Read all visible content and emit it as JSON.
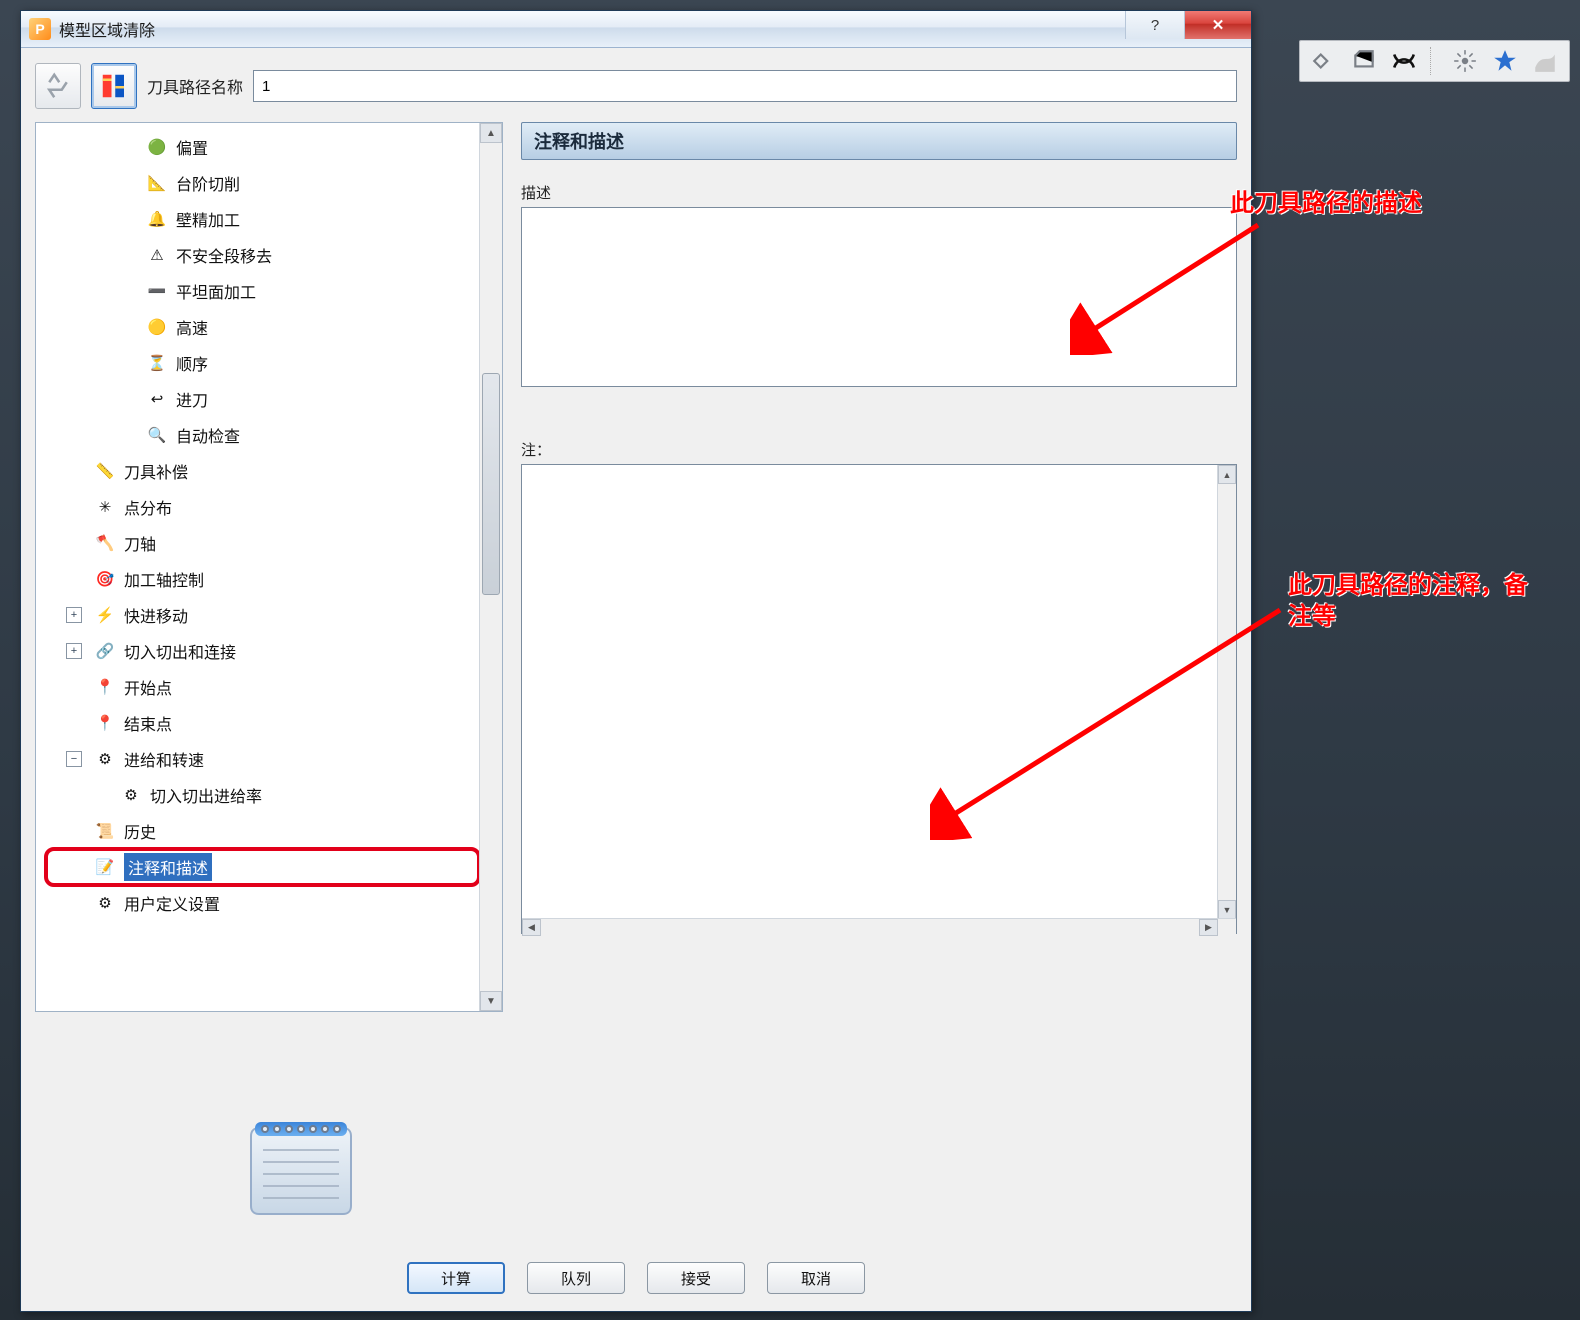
{
  "window": {
    "title": "模型区域清除",
    "app_letter": "P",
    "help_symbol": "?",
    "close_symbol": "✕"
  },
  "header": {
    "path_label": "刀具路径名称",
    "path_value": "1"
  },
  "tree": {
    "items": [
      {
        "indent": 3,
        "icon": "🟢",
        "label": "偏置"
      },
      {
        "indent": 3,
        "icon": "📐",
        "label": "台阶切削"
      },
      {
        "indent": 3,
        "icon": "🔔",
        "label": "壁精加工"
      },
      {
        "indent": 3,
        "icon": "⚠",
        "label": "不安全段移去"
      },
      {
        "indent": 3,
        "icon": "➖",
        "label": "平坦面加工"
      },
      {
        "indent": 3,
        "icon": "🟡",
        "label": "高速"
      },
      {
        "indent": 3,
        "icon": "⏳",
        "label": "顺序"
      },
      {
        "indent": 3,
        "icon": "↩",
        "label": "进刀"
      },
      {
        "indent": 3,
        "icon": "🔍",
        "label": "自动检查"
      },
      {
        "indent": 1,
        "icon": "📏",
        "label": "刀具补偿"
      },
      {
        "indent": 1,
        "icon": "✳",
        "label": "点分布"
      },
      {
        "indent": 1,
        "icon": "🪓",
        "label": "刀轴"
      },
      {
        "indent": 1,
        "icon": "🎯",
        "label": "加工轴控制"
      },
      {
        "indent": 1,
        "exp": "+",
        "icon": "⚡",
        "label": "快进移动"
      },
      {
        "indent": 1,
        "exp": "+",
        "icon": "🔗",
        "label": "切入切出和连接"
      },
      {
        "indent": 1,
        "icon": "📍",
        "label": "开始点"
      },
      {
        "indent": 1,
        "icon": "📍",
        "label": "结束点"
      },
      {
        "indent": 1,
        "exp": "−",
        "icon": "⚙",
        "label": "进给和转速"
      },
      {
        "indent": 2,
        "icon": "⚙",
        "label": "切入切出进给率"
      },
      {
        "indent": 1,
        "icon": "📜",
        "label": "历史"
      },
      {
        "indent": 1,
        "icon": "📝",
        "label": "注释和描述",
        "selected": true,
        "highlight": true
      },
      {
        "indent": 1,
        "icon": "⚙",
        "label": "用户定义设置"
      }
    ]
  },
  "panel": {
    "heading": "注释和描述",
    "desc_label": "描述",
    "notes_label": "注："
  },
  "buttons": {
    "compute": "计算",
    "queue": "队列",
    "accept": "接受",
    "cancel": "取消"
  },
  "annotations": {
    "anno1": "此刀具路径的描述",
    "anno2": "此刀具路径的注释，备注等"
  }
}
